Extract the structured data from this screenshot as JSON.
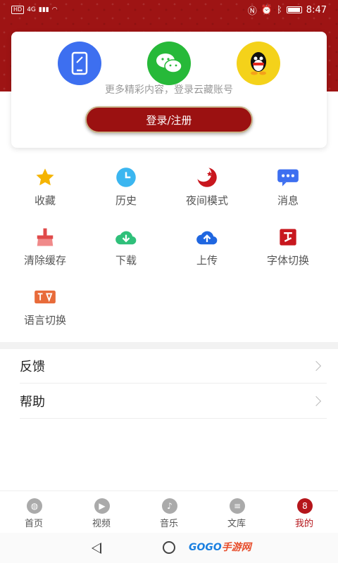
{
  "status_bar": {
    "left_text": "4G",
    "time": "8:47"
  },
  "login": {
    "social_icons": [
      "phone-icon",
      "wechat-icon",
      "qq-icon"
    ],
    "hint": "更多精彩内容，登录云藏账号",
    "button_label": "登录/注册"
  },
  "grid": [
    {
      "label": "收藏",
      "icon": "star-icon",
      "color": "#f5b400"
    },
    {
      "label": "历史",
      "icon": "clock-icon",
      "color": "#3bb6f0"
    },
    {
      "label": "夜间模式",
      "icon": "moon-icon",
      "color": "#c8171e"
    },
    {
      "label": "消息",
      "icon": "message-icon",
      "color": "#3d6ff0"
    },
    {
      "label": "清除缓存",
      "icon": "broom-icon",
      "color": "#e04a4a"
    },
    {
      "label": "下载",
      "icon": "cloud-download-icon",
      "color": "#2fc07a"
    },
    {
      "label": "上传",
      "icon": "cloud-upload-icon",
      "color": "#1f66e0"
    },
    {
      "label": "字体切换",
      "icon": "font-icon",
      "color": "#c8171e"
    },
    {
      "label": "语言切换",
      "icon": "language-icon",
      "color": "#e86b3a"
    }
  ],
  "list": [
    {
      "label": "反馈"
    },
    {
      "label": "帮助"
    }
  ],
  "tabs": [
    {
      "label": "首页",
      "icon": "home-icon"
    },
    {
      "label": "视频",
      "icon": "video-icon"
    },
    {
      "label": "音乐",
      "icon": "music-icon"
    },
    {
      "label": "文库",
      "icon": "library-icon"
    },
    {
      "label": "我的",
      "icon": "profile-icon",
      "active": true
    }
  ],
  "watermark": {
    "part1": "GOGO",
    "part2": "手游网"
  }
}
